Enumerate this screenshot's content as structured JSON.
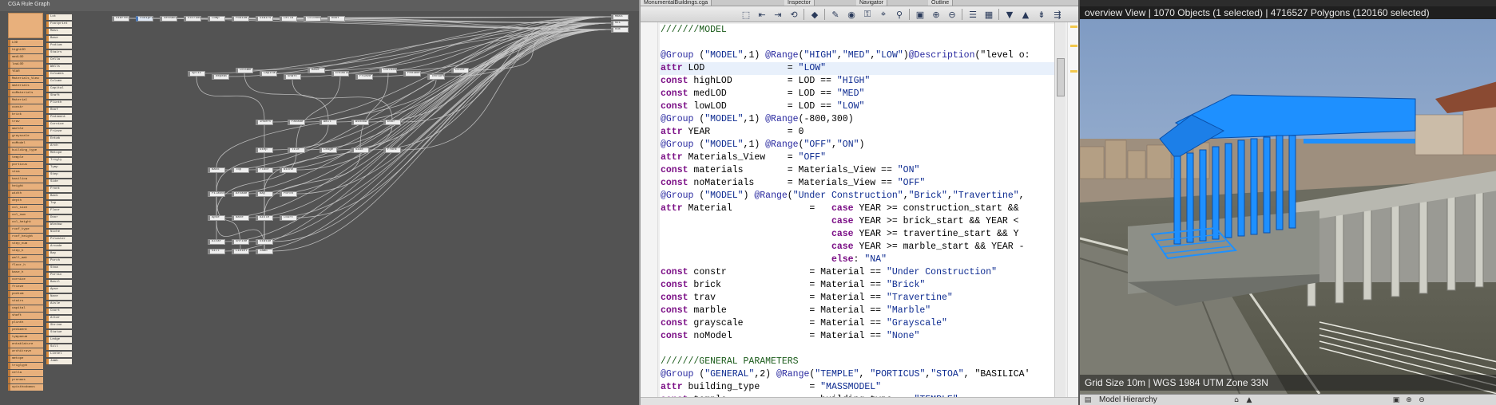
{
  "graph": {
    "title": "CGA Rule Graph",
    "attributes_a": [
      "LOD",
      "highLOD",
      "medLOD",
      "lowLOD",
      "YEAR",
      "Materials_View",
      "materials",
      "noMaterials",
      "Material",
      "constr",
      "brick",
      "trav",
      "marble",
      "grayscale",
      "noModel",
      "building_type",
      "temple",
      "porticus",
      "stoa",
      "basilica",
      "height",
      "width",
      "depth",
      "col_size",
      "col_num",
      "col_height",
      "roof_type",
      "roof_height",
      "step_num",
      "step_h",
      "wall_mat",
      "floor_h",
      "base_h",
      "cornice",
      "frieze",
      "podium",
      "stairs",
      "capital",
      "shaft",
      "plinth",
      "pediment",
      "tympanum",
      "entablature",
      "architrave",
      "metope",
      "triglyph",
      "cella",
      "pronaos",
      "opisthodomos"
    ],
    "attributes_b": [
      "Lot",
      "Footprint",
      "Mass",
      "Base",
      "Podium",
      "Stairs",
      "Cella",
      "Walls",
      "Columns",
      "Column",
      "Capital",
      "Shaft",
      "Plinth",
      "Roof",
      "Pediment",
      "Cornice",
      "Frieze",
      "Entab",
      "Arch",
      "Metope",
      "Trigly",
      "Tymp",
      "Step",
      "Side",
      "Front",
      "Back",
      "Top",
      "Floor",
      "Door",
      "Window",
      "Niche",
      "Pilaster",
      "Arcade",
      "Bay",
      "Porch",
      "Stoa",
      "Portic",
      "Basil",
      "Apse",
      "Nave",
      "Aisle",
      "Court",
      "Altar",
      "Shrine",
      "Statue",
      "Ledge",
      "Sill",
      "Lintel",
      "Jamb"
    ],
    "nodes": [
      {
        "label": "StartRule",
        "sel": false
      },
      {
        "label": "Footprint",
        "sel": true
      },
      {
        "label": "SetBack",
        "sel": false
      },
      {
        "label": "Extrude",
        "sel": false
      },
      {
        "label": "Comp",
        "sel": false
      },
      {
        "label": "Podium",
        "sel": false
      },
      {
        "label": "Stairs",
        "sel": false
      },
      {
        "label": "Cella",
        "sel": false
      },
      {
        "label": "Colonnade",
        "sel": false
      },
      {
        "label": "Roof",
        "sel": false
      },
      {
        "label": "Split",
        "sel": false
      },
      {
        "label": "Repeat",
        "sel": false
      },
      {
        "label": "Column",
        "sel": false
      },
      {
        "label": "Capital",
        "sel": false
      },
      {
        "label": "Shaft",
        "sel": false
      },
      {
        "label": "Base",
        "sel": false
      },
      {
        "label": "Entablature",
        "sel": false
      },
      {
        "label": "Frieze",
        "sel": false
      },
      {
        "label": "Cornice",
        "sel": false
      },
      {
        "label": "Pediment",
        "sel": false
      },
      {
        "label": "Texture",
        "sel": false
      },
      {
        "label": "Color",
        "sel": false
      },
      {
        "label": "Insert",
        "sel": false
      },
      {
        "label": "Facade",
        "sel": false
      },
      {
        "label": "Wall",
        "sel": false
      },
      {
        "label": "Window",
        "sel": false
      },
      {
        "label": "Door",
        "sel": false
      },
      {
        "label": "Step",
        "sel": false
      },
      {
        "label": "Tile",
        "sel": false
      },
      {
        "label": "Ledge",
        "sel": false
      },
      {
        "label": "Side",
        "sel": false
      },
      {
        "label": "Front",
        "sel": false
      },
      {
        "label": "Back",
        "sel": false
      },
      {
        "label": "Top",
        "sel": false
      },
      {
        "label": "Floor",
        "sel": false
      },
      {
        "label": "Niche",
        "sel": false
      },
      {
        "label": "Pilaster",
        "sel": false
      },
      {
        "label": "Arcade",
        "sel": false
      },
      {
        "label": "Bay",
        "sel": false
      },
      {
        "label": "Porch",
        "sel": false
      },
      {
        "label": "Apse",
        "sel": false
      },
      {
        "label": "Nave",
        "sel": false
      },
      {
        "label": "Aisle",
        "sel": false
      },
      {
        "label": "Court",
        "sel": false
      },
      {
        "label": "Altar",
        "sel": false
      },
      {
        "label": "Shrine",
        "sel": false
      },
      {
        "label": "Statue",
        "sel": false
      },
      {
        "label": "Sill",
        "sel": false
      },
      {
        "label": "Lintel",
        "sel": false
      },
      {
        "label": "Jamb",
        "sel": false
      },
      {
        "label": "Mass",
        "sel": false
      },
      {
        "label": "NIL",
        "sel": false
      },
      {
        "label": "Out",
        "sel": false
      }
    ]
  },
  "editor": {
    "tabs": [
      "MonumentalBuildings.cga",
      "Inspector",
      "Navigator",
      "Outline"
    ],
    "toolbar_icons": [
      "select-icon",
      "move-icon",
      "scale-icon",
      "rotate-icon",
      "shape-icon",
      "paint-icon",
      "camera-icon",
      "lock-icon",
      "snap-icon",
      "search-icon",
      "frame-icon",
      "zoom-in-icon",
      "zoom-out-icon",
      "layout-icon",
      "grid-icon",
      "filter-icon",
      "arrow-up-icon",
      "arrow-down-icon"
    ],
    "lines": [
      {
        "text": "///////MODEL",
        "kind": "comment"
      },
      {
        "text": "",
        "kind": "blank"
      },
      {
        "text": "@Group (\"MODEL\",1) @Range(\"HIGH\",\"MED\",\"LOW\")@Description(\"level o:",
        "kind": "annot"
      },
      {
        "text": "attr LOD               = \"LOW\"",
        "kind": "attr",
        "current": true
      },
      {
        "text": "const highLOD          = LOD == \"HIGH\"",
        "kind": "const"
      },
      {
        "text": "const medLOD           = LOD == \"MED\"",
        "kind": "const"
      },
      {
        "text": "const lowLOD           = LOD == \"LOW\"",
        "kind": "const"
      },
      {
        "text": "@Group (\"MODEL\",1) @Range(-800,300)",
        "kind": "annot"
      },
      {
        "text": "attr YEAR              = 0",
        "kind": "attr"
      },
      {
        "text": "@Group (\"MODEL\",1) @Range(\"OFF\",\"ON\")",
        "kind": "annot"
      },
      {
        "text": "attr Materials_View    = \"OFF\"",
        "kind": "attr"
      },
      {
        "text": "const materials        = Materials_View == \"ON\"",
        "kind": "const"
      },
      {
        "text": "const noMaterials      = Materials_View == \"OFF\"",
        "kind": "const"
      },
      {
        "text": "@Group (\"MODEL\") @Range(\"Under Construction\",\"Brick\",\"Travertine\",",
        "kind": "annot"
      },
      {
        "text": "attr Material              =   case YEAR >= construction_start &&",
        "kind": "attr"
      },
      {
        "text": "                               case YEAR >= brick_start && YEAR <",
        "kind": "case"
      },
      {
        "text": "                               case YEAR >= travertine_start && Y",
        "kind": "case"
      },
      {
        "text": "                               case YEAR >= marble_start && YEAR -",
        "kind": "case"
      },
      {
        "text": "                               else: \"NA\"",
        "kind": "case"
      },
      {
        "text": "const constr               = Material == \"Under Construction\"",
        "kind": "const"
      },
      {
        "text": "const brick                = Material == \"Brick\"",
        "kind": "const"
      },
      {
        "text": "const trav                 = Material == \"Travertine\"",
        "kind": "const"
      },
      {
        "text": "const marble               = Material == \"Marble\"",
        "kind": "const"
      },
      {
        "text": "const grayscale            = Material == \"Grayscale\"",
        "kind": "const"
      },
      {
        "text": "const noModel              = Material == \"None\"",
        "kind": "const"
      },
      {
        "text": "",
        "kind": "blank"
      },
      {
        "text": "///////GENERAL PARAMETERS",
        "kind": "comment"
      },
      {
        "text": "@Group (\"GENERAL\",2) @Range(\"TEMPLE\", \"PORTICUS\",\"STOA\", \"BASILICA'",
        "kind": "annot"
      },
      {
        "text": "attr building_type         = \"MASSMODEL\"",
        "kind": "attr"
      },
      {
        "text": "const temple               = building_type == \"TEMPLE\"",
        "kind": "const"
      }
    ]
  },
  "viewport": {
    "status": "overview View  |  1070 Objects  (1 selected)  |  4716527 Polygons  (120160 selected)",
    "footer": "Grid Size 10m  |  WGS 1984 UTM Zone 33N",
    "bottom_title": "Model Hierarchy",
    "bottom_icons": [
      "pin-icon",
      "triangle-icon",
      "zoom-in-icon",
      "zoom-out-icon",
      "frame-icon"
    ],
    "selection_color": "#1e90ff",
    "sky_color": "#8aa3c7"
  }
}
